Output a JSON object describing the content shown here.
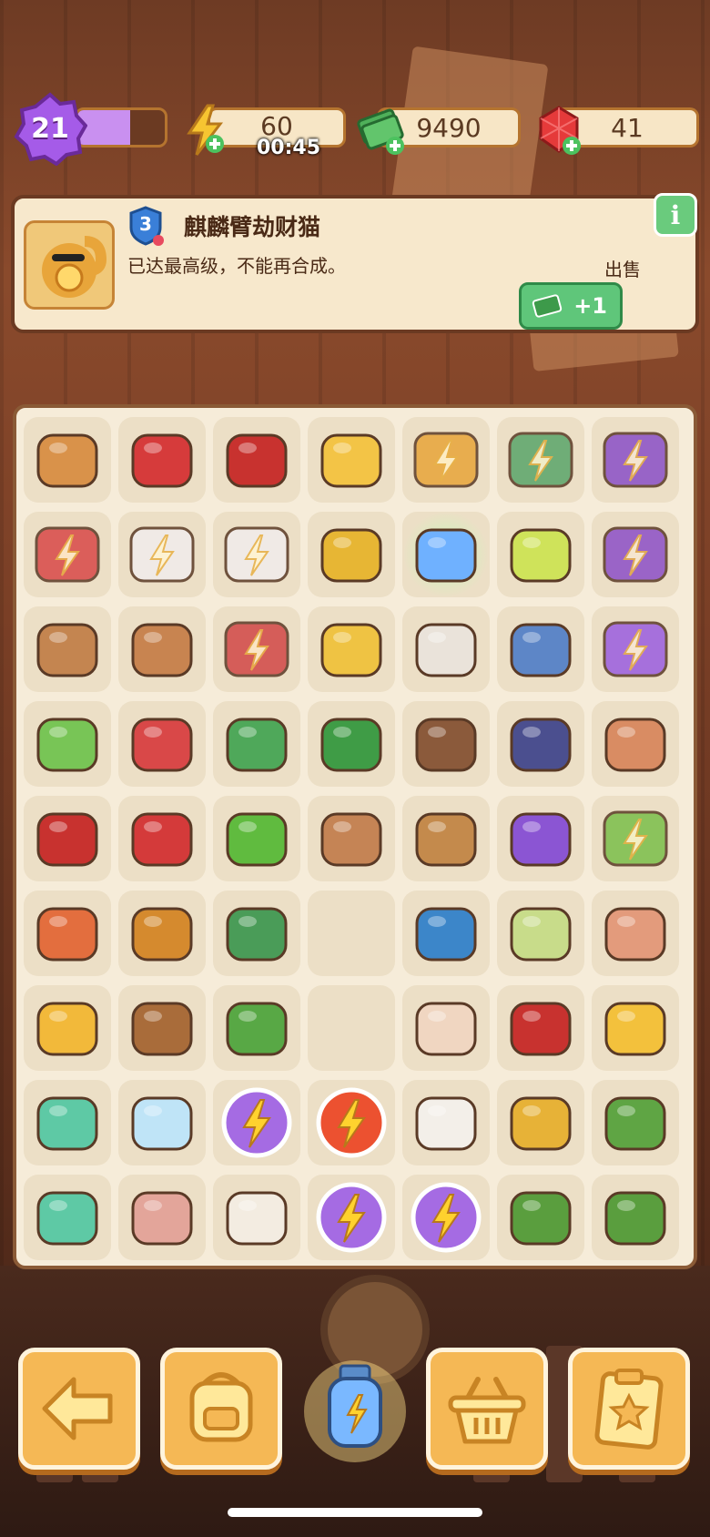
{
  "stats": {
    "level": "21",
    "xp_fraction": 0.6,
    "energy": "60",
    "energy_timer": "00:45",
    "cash": "9490",
    "gems": "41"
  },
  "info_panel": {
    "item_level": "3",
    "item_name": "麒麟臂劫财猫",
    "description": "已达最高级，不能再合成。",
    "sell_label": "出售",
    "sell_value": "+1"
  },
  "board": {
    "rows": [
      [
        "wooden-crate",
        "red-box-open",
        "red-toolbox",
        "bucket",
        "lucky-cat-locked",
        "gem-chest-locked",
        "motorcycle-locked"
      ],
      [
        "red-machine-locked",
        "white-machine-locked",
        "white-machine-locked",
        "yellow-ring",
        "energy-bottle",
        "lotion-bottle",
        "atv-locked"
      ],
      [
        "clay-pot-broken",
        "clay-pot",
        "winged-machine-locked",
        "gold-bowl",
        "photo-album",
        "flower-vase",
        "purple-car-locked"
      ],
      [
        "green-machine",
        "hand-rake",
        "brush-broom",
        "green-brush",
        "leaf-stamp",
        "bike-wheels",
        "vase-ornament"
      ],
      [
        "red-glove",
        "pruning-shears",
        "green-broom",
        "clay-shard",
        "treasure-chest",
        "purple-scooter",
        "plant-pot-locked"
      ],
      [
        "camera",
        "binoculars",
        "green-brush-2",
        "empty",
        "blue-chest",
        "melon",
        "glass-bottle"
      ],
      [
        "sunglasses",
        "telescope",
        "green-dish",
        "empty",
        "white-vase",
        "red-glove",
        "iced-drink"
      ],
      [
        "medkit",
        "ice-block",
        "energy-orb-purple",
        "energy-orb-red",
        "white-block",
        "canned-food",
        "flower-bush"
      ],
      [
        "medkit",
        "pink-vase",
        "tofu-bricks",
        "energy-orb-purple",
        "energy-orb-purple",
        "flower-garden",
        "flower-garden"
      ]
    ]
  },
  "toolbar": [
    "back-arrow",
    "backpack",
    "energy-bottle",
    "basket",
    "task-list"
  ],
  "colors": {
    "accent": "#f5b855",
    "panel": "#f7e8cc",
    "green": "#5fc67a",
    "purple": "#a55be8"
  }
}
